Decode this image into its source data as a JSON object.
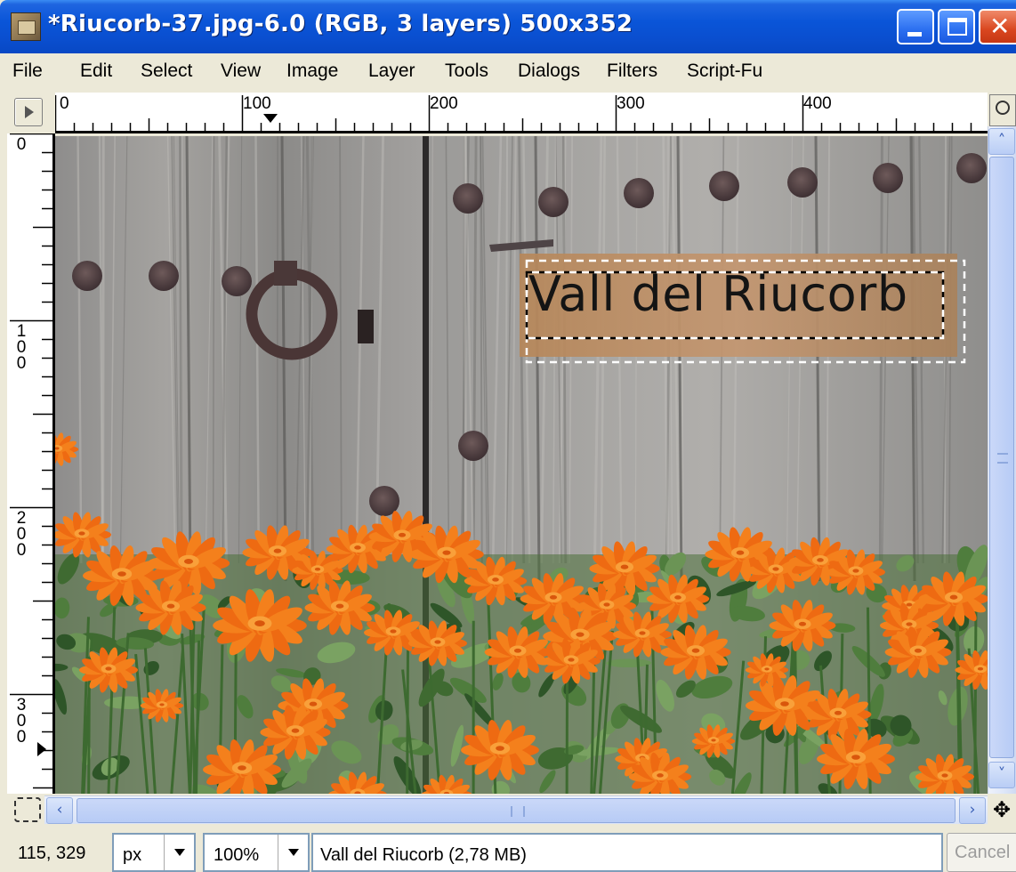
{
  "window": {
    "title": "*Riucorb-37.jpg-6.0 (RGB, 3 layers) 500x352"
  },
  "menu": [
    "File",
    "Edit",
    "Select",
    "View",
    "Image",
    "Layer",
    "Tools",
    "Dialogs",
    "Filters",
    "Script-Fu"
  ],
  "rulers": {
    "horizontal": [
      "0",
      "100",
      "200",
      "300",
      "400"
    ],
    "vertical": [
      "0",
      "100",
      "200",
      "300"
    ]
  },
  "canvas": {
    "text_layer": "Vall del Riucorb"
  },
  "status": {
    "coords": "115, 329",
    "unit": "px",
    "zoom": "100%",
    "message": "Vall del Riucorb (2,78 MB)",
    "cancel_label": "Cancel"
  },
  "icons": {
    "app": "gimp-image-icon",
    "minimize": "minimize-icon",
    "maximize": "maximize-icon",
    "close": "close-icon",
    "menu_arrow": "menu-arrow-icon",
    "zoom": "zoom-icon",
    "quick_mask": "quick-mask-icon",
    "navigate": "navigate-icon"
  },
  "colors": {
    "titlebar": "#0a55d8",
    "close_button": "#d9461f",
    "ui_background": "#ece9d8",
    "text_box": "#b98a5e",
    "flower": "#f07a1a"
  }
}
